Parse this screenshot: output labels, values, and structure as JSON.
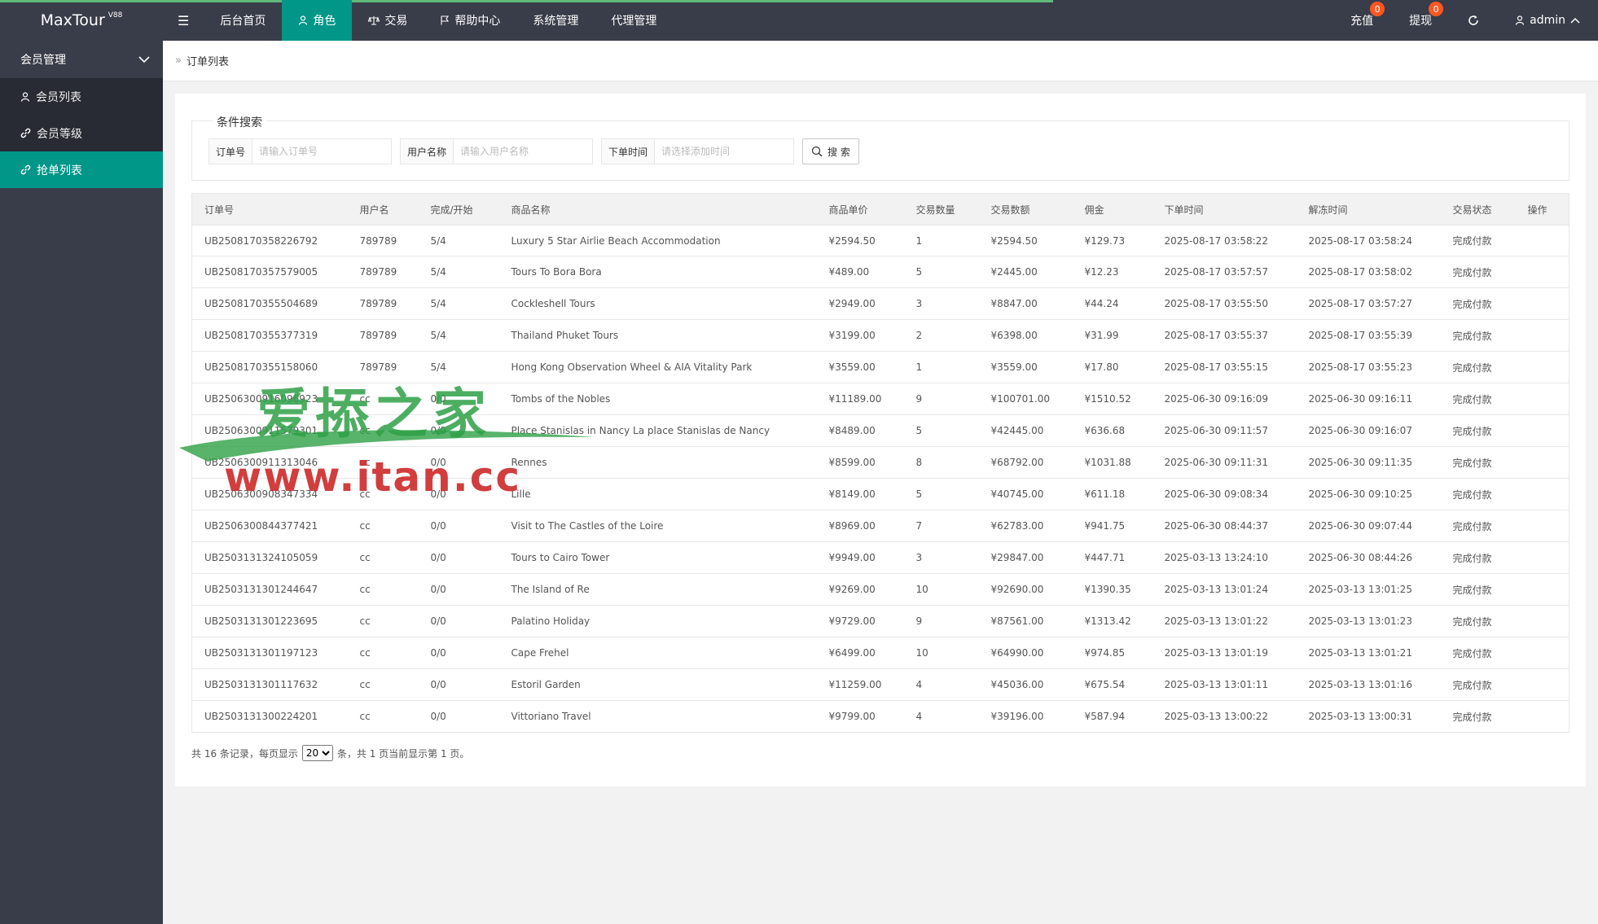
{
  "app": {
    "logo": "MaxTour",
    "logo_sup": "V88"
  },
  "nav": {
    "items": [
      {
        "label": "后台首页",
        "icon": "",
        "active": false
      },
      {
        "label": "角色",
        "icon": "user-icon",
        "active": true
      },
      {
        "label": "交易",
        "icon": "scale-icon",
        "active": false
      },
      {
        "label": "帮助中心",
        "icon": "flag-icon",
        "active": false
      },
      {
        "label": "系统管理",
        "icon": "",
        "active": false
      },
      {
        "label": "代理管理",
        "icon": "",
        "active": false
      }
    ],
    "right": {
      "recharge": "充值",
      "recharge_badge": "0",
      "withdraw": "提现",
      "withdraw_badge": "0",
      "user": "admin"
    }
  },
  "sidebar": {
    "group": "会员管理",
    "items": [
      {
        "label": "会员列表",
        "icon": "user-icon"
      },
      {
        "label": "会员等级",
        "icon": "link-icon"
      },
      {
        "label": "抢单列表",
        "icon": "link-icon",
        "active": true
      }
    ]
  },
  "breadcrumb": {
    "current": "订单列表"
  },
  "search": {
    "legend": "条件搜索",
    "order_label": "订单号",
    "order_placeholder": "请输入订单号",
    "user_label": "用户名称",
    "user_placeholder": "请输入用户名称",
    "time_label": "下单时间",
    "time_placeholder": "请选择添加时间",
    "button": "搜 索"
  },
  "table": {
    "headers": [
      "订单号",
      "用户名",
      "完成/开始",
      "商品名称",
      "商品单价",
      "交易数量",
      "交易数额",
      "佣金",
      "下单时间",
      "解冻时间",
      "交易状态",
      "操作"
    ],
    "rows": [
      [
        "UB2508170358226792",
        "789789",
        "5/4",
        "Luxury 5 Star Airlie Beach Accommodation",
        "¥2594.50",
        "1",
        "¥2594.50",
        "¥129.73",
        "2025-08-17 03:58:22",
        "2025-08-17 03:58:24",
        "完成付款",
        ""
      ],
      [
        "UB2508170357579005",
        "789789",
        "5/4",
        "Tours To Bora Bora",
        "¥489.00",
        "5",
        "¥2445.00",
        "¥12.23",
        "2025-08-17 03:57:57",
        "2025-08-17 03:58:02",
        "完成付款",
        ""
      ],
      [
        "UB2508170355504689",
        "789789",
        "5/4",
        "Cockleshell Tours",
        "¥2949.00",
        "3",
        "¥8847.00",
        "¥44.24",
        "2025-08-17 03:55:50",
        "2025-08-17 03:57:27",
        "完成付款",
        ""
      ],
      [
        "UB2508170355377319",
        "789789",
        "5/4",
        "Thailand Phuket Tours",
        "¥3199.00",
        "2",
        "¥6398.00",
        "¥31.99",
        "2025-08-17 03:55:37",
        "2025-08-17 03:55:39",
        "完成付款",
        ""
      ],
      [
        "UB2508170355158060",
        "789789",
        "5/4",
        "Hong Kong Observation Wheel & AIA Vitality Park",
        "¥3559.00",
        "1",
        "¥3559.00",
        "¥17.80",
        "2025-08-17 03:55:15",
        "2025-08-17 03:55:23",
        "完成付款",
        ""
      ],
      [
        "UB2506300916096923",
        "cc",
        "0/0",
        "Tombs of the Nobles",
        "¥11189.00",
        "9",
        "¥100701.00",
        "¥1510.52",
        "2025-06-30 09:16:09",
        "2025-06-30 09:16:11",
        "完成付款",
        ""
      ],
      [
        "UB2506300911579301",
        "cc",
        "0/0",
        "Place Stanislas in Nancy La place Stanislas de Nancy",
        "¥8489.00",
        "5",
        "¥42445.00",
        "¥636.68",
        "2025-06-30 09:11:57",
        "2025-06-30 09:16:07",
        "完成付款",
        ""
      ],
      [
        "UB2506300911313046",
        "cc",
        "0/0",
        "Rennes",
        "¥8599.00",
        "8",
        "¥68792.00",
        "¥1031.88",
        "2025-06-30 09:11:31",
        "2025-06-30 09:11:35",
        "完成付款",
        ""
      ],
      [
        "UB2506300908347334",
        "cc",
        "0/0",
        "Lille",
        "¥8149.00",
        "5",
        "¥40745.00",
        "¥611.18",
        "2025-06-30 09:08:34",
        "2025-06-30 09:10:25",
        "完成付款",
        ""
      ],
      [
        "UB2506300844377421",
        "cc",
        "0/0",
        "Visit to The Castles of the Loire",
        "¥8969.00",
        "7",
        "¥62783.00",
        "¥941.75",
        "2025-06-30 08:44:37",
        "2025-06-30 09:07:44",
        "完成付款",
        ""
      ],
      [
        "UB2503131324105059",
        "cc",
        "0/0",
        "Tours to Cairo Tower",
        "¥9949.00",
        "3",
        "¥29847.00",
        "¥447.71",
        "2025-03-13 13:24:10",
        "2025-06-30 08:44:26",
        "完成付款",
        ""
      ],
      [
        "UB2503131301244647",
        "cc",
        "0/0",
        "The Island of Re",
        "¥9269.00",
        "10",
        "¥92690.00",
        "¥1390.35",
        "2025-03-13 13:01:24",
        "2025-03-13 13:01:25",
        "完成付款",
        ""
      ],
      [
        "UB2503131301223695",
        "cc",
        "0/0",
        "Palatino Holiday",
        "¥9729.00",
        "9",
        "¥87561.00",
        "¥1313.42",
        "2025-03-13 13:01:22",
        "2025-03-13 13:01:23",
        "完成付款",
        ""
      ],
      [
        "UB2503131301197123",
        "cc",
        "0/0",
        "Cape Frehel",
        "¥6499.00",
        "10",
        "¥64990.00",
        "¥974.85",
        "2025-03-13 13:01:19",
        "2025-03-13 13:01:21",
        "完成付款",
        ""
      ],
      [
        "UB2503131301117632",
        "cc",
        "0/0",
        "Estoril Garden",
        "¥11259.00",
        "4",
        "¥45036.00",
        "¥675.54",
        "2025-03-13 13:01:11",
        "2025-03-13 13:01:16",
        "完成付款",
        ""
      ],
      [
        "UB2503131300224201",
        "cc",
        "0/0",
        "Vittoriano Travel",
        "¥9799.00",
        "4",
        "¥39196.00",
        "¥587.94",
        "2025-03-13 13:00:22",
        "2025-03-13 13:00:31",
        "完成付款",
        ""
      ]
    ]
  },
  "pager": {
    "prefix": "共 16 条记录，每页显示",
    "page_size": "20",
    "suffix": "条，共 1 页当前显示第 1 页。"
  },
  "watermark": {
    "cn": "爱掭之家",
    "url": "www.itan.cc"
  }
}
